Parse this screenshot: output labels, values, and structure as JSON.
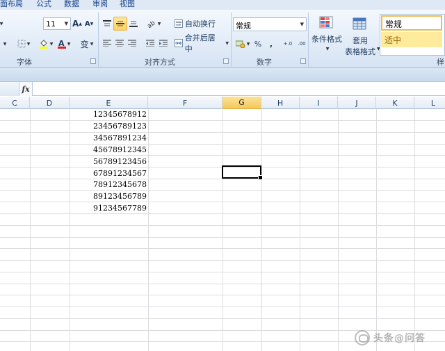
{
  "tabs": [
    "面布局",
    "公式",
    "数据",
    "审阅",
    "视图"
  ],
  "font_group": {
    "size": "11",
    "grow_label": "A",
    "shrink_label": "A",
    "label": "字体",
    "phonetic_label": "变"
  },
  "align_group": {
    "wrap_label": "自动换行",
    "merge_label": "合并后居中",
    "label": "对齐方式"
  },
  "number_group": {
    "format": "常规",
    "percent": "%",
    "comma": ",",
    "inc_decimal": "+.0",
    "dec_decimal": ".00",
    "label": "数字"
  },
  "styles_group": {
    "cond_format": "条件格式",
    "table_format_line1": "套用",
    "table_format_line2": "表格格式",
    "style_normal": "常规",
    "style_neutral": "适中",
    "label_partial": "样"
  },
  "formula_bar": {
    "fx": "fx",
    "value": ""
  },
  "columns": [
    "C",
    "D",
    "E",
    "F",
    "G",
    "H",
    "I",
    "J",
    "K",
    "L"
  ],
  "active_column": "G",
  "cells_E": [
    "12345678912",
    "23456789123",
    "34567891234",
    "45678912345",
    "56789123456",
    "67891234567",
    "78912345678",
    "89123456789",
    "91234567789"
  ],
  "watermark": "头条@问答",
  "colors": {
    "active_header": "#f5c75b",
    "selected_button": "#ffd35c",
    "neutral_style_bg": "#ffeb9c",
    "neutral_style_text": "#9c6500"
  }
}
